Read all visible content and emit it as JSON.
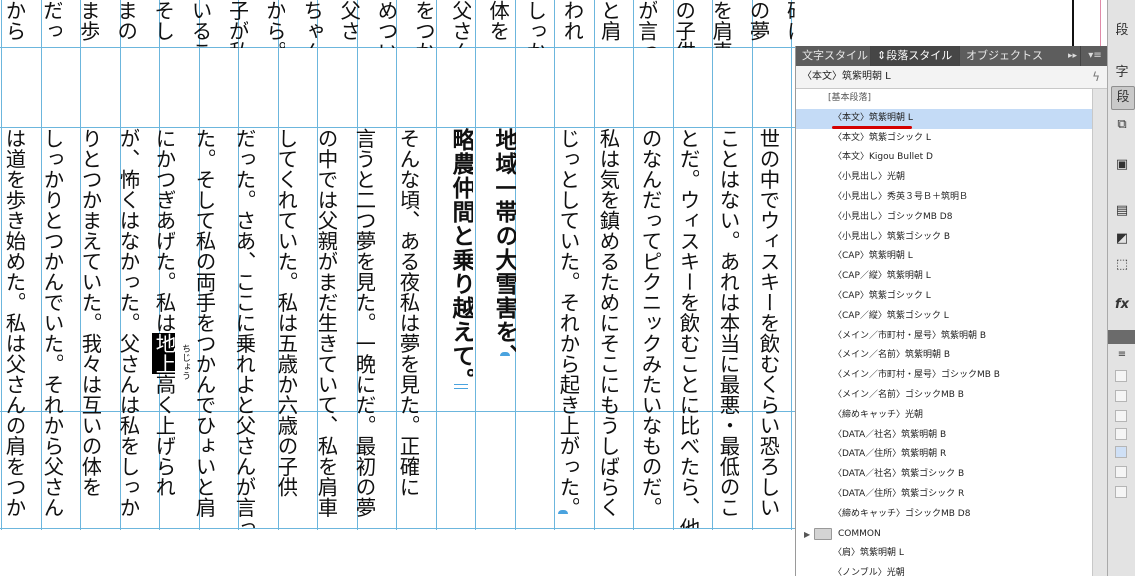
{
  "document": {
    "top_columns": [
      "から",
      "だっ",
      "ま歩",
      "まの",
      "そし",
      "いるこ",
      "子が私",
      "から。",
      "ちゃん",
      "父さ",
      "めつい",
      "をつか",
      "父さん",
      "体を",
      "しっか",
      "われ",
      "と肩",
      "が言っ",
      "の子供",
      "を肩車",
      "の夢",
      "確に"
    ],
    "body_columns": [
      "は道を歩き始めた。私は父さんの肩をつか",
      "しっかりとつかんでいた。それから父さん",
      "りとつかまえていた。我々は互いの体を",
      "が、怖くはなかった。父さんは私をしっか",
      "にかつぎあげた。私は",
      "た。そして私の両手をつかんでひょいと肩",
      "だった。さあ、ここに乗れよと父さんが言っ",
      "してくれていた。私は五歳か六歳の子供",
      "の中では父親がまだ生きていて、私を肩車",
      "言うと二つ夢を見た。一晩にだ。最初の夢",
      "そんな頃、ある夜私は夢を見た。正確に",
      "じっとしていた。それから起き上がった。",
      "私は気を鎮めるためにそこにもうしばらく",
      "のなんだってピクニックみたいなものだ。",
      "とだ。ウィスキーを飲むことに比べたら、他",
      "ことはない。あれは本当に最悪・最低のこ",
      "世の中でウィスキーを飲むくらい恐ろしい"
    ],
    "highlight_word": "地上",
    "highlight_rest": "高く上げられ",
    "ruby_text": "ちじょう",
    "headline_lines": [
      "略農仲間と乗り越えて。",
      "地域一帯の大雪害を、"
    ]
  },
  "panel": {
    "tabs": [
      "文字スタイル",
      "段落スタイル",
      "オブジェクトス"
    ],
    "tab_arrows": "▸▸",
    "menu_icon": "▾≡",
    "current_style": "〈本文〉筑紫明朝 L",
    "styles": [
      "[基本段落]",
      "〈本文〉筑紫明朝 L",
      "〈本文〉筑紫ゴシック L",
      "〈本文〉Kigou Bullet D",
      "〈小見出し〉光朝",
      "〈小見出し〉秀英３号Ｂ＋筑明Ｂ",
      "〈小見出し〉ゴシックMB D8",
      "〈小見出し〉筑紫ゴシック B",
      "〈CAP〉筑紫明朝 L",
      "〈CAP／縦〉筑紫明朝 L",
      "〈CAP〉筑紫ゴシック L",
      "〈CAP／縦〉筑紫ゴシック L",
      "〈メイン／市町村・屋号〉筑紫明朝 B",
      "〈メイン／名前〉筑紫明朝 B",
      "〈メイン／市町村・屋号〉ゴシックMB B",
      "〈メイン／名前〉ゴシックMB B",
      "〈締めキャッチ〉光朝",
      "〈DATA／社名〉筑紫明朝 B",
      "〈DATA／住所〉筑紫明朝 R",
      "〈DATA／社名〉筑紫ゴシック B",
      "〈DATA／住所〉筑紫ゴシック R",
      "〈締めキャッチ〉ゴシックMB D8"
    ],
    "group_name": "COMMON",
    "group_items": [
      "〈肩〉筑紫明朝 L",
      "〈ノンブル〉光朝"
    ],
    "selected_index": 1
  },
  "toolstrip": {
    "char_label": "字",
    "para_label": "段",
    "fx_label": "fx"
  },
  "colors": {
    "guide": "#6cb6dd",
    "selection": "#c4dbf6",
    "underline": "#d40000",
    "panel_tab_bg": "#5d5d5d"
  }
}
